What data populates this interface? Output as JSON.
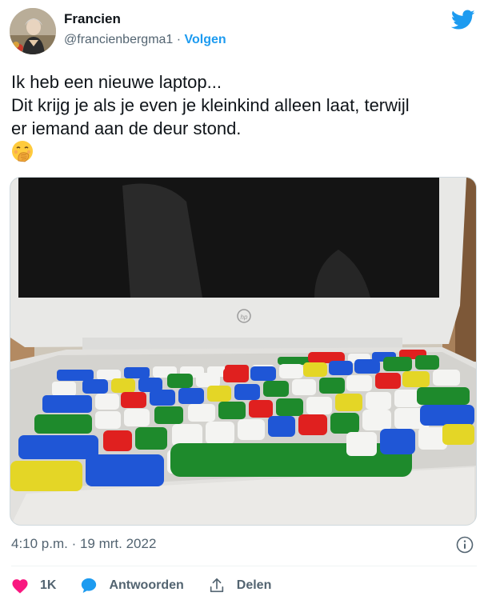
{
  "author": {
    "name": "Francien",
    "handle": "@francienbergma1",
    "separator": "·",
    "follow_label": "Volgen"
  },
  "tweet": {
    "lines": [
      "Ik heb een nieuwe laptop...",
      "Dit krijg je als je even je kleinkind alleen laat, terwijl",
      "er iemand aan de deur stond."
    ],
    "emoji": "face-with-hand-over-mouth-emoji",
    "photo_logo": "hp",
    "timestamp": "4:10 p.m. · 19 mrt. 2022"
  },
  "actions": {
    "likes": "1K",
    "reply_label": "Antwoorden",
    "share_label": "Delen"
  },
  "colors": {
    "accent": "#1d9bf0",
    "like": "#f91880",
    "secondary_text": "#536471",
    "key_blue": "#1f56d6",
    "key_red": "#e0201f",
    "key_green": "#1e8a2c",
    "key_yellow": "#e4d626"
  },
  "icons": [
    "twitter-bird-icon",
    "info-icon",
    "heart-icon",
    "reply-bubble-icon",
    "share-icon"
  ]
}
